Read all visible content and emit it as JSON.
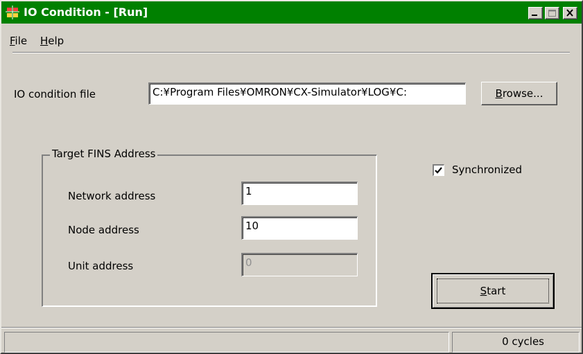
{
  "window": {
    "title": "IO Condition - [Run]",
    "title_bar_color": "#008000",
    "controls": [
      "minimize-icon",
      "maximize-icon",
      "close-icon"
    ]
  },
  "menu": {
    "file": {
      "mnemonic": "F",
      "rest": "ile"
    },
    "help": {
      "mnemonic": "H",
      "rest": "elp"
    }
  },
  "io_condition": {
    "label": "IO condition file",
    "file_path": "C:¥Program Files¥OMRON¥CX-Simulator¥LOG¥C:",
    "browse": {
      "mnemonic": "B",
      "rest": "rowse..."
    }
  },
  "target_fins": {
    "group_title": "Target FINS Address",
    "network": {
      "label": "Network address",
      "value": "1"
    },
    "node": {
      "label": "Node address",
      "value": "10"
    },
    "unit": {
      "label": "Unit address",
      "value": "0"
    }
  },
  "synchronized": {
    "label": "Synchronized",
    "checked": true
  },
  "start": {
    "mnemonic": "S",
    "rest": "tart"
  },
  "status": {
    "left": "",
    "cycles": "0 cycles"
  }
}
